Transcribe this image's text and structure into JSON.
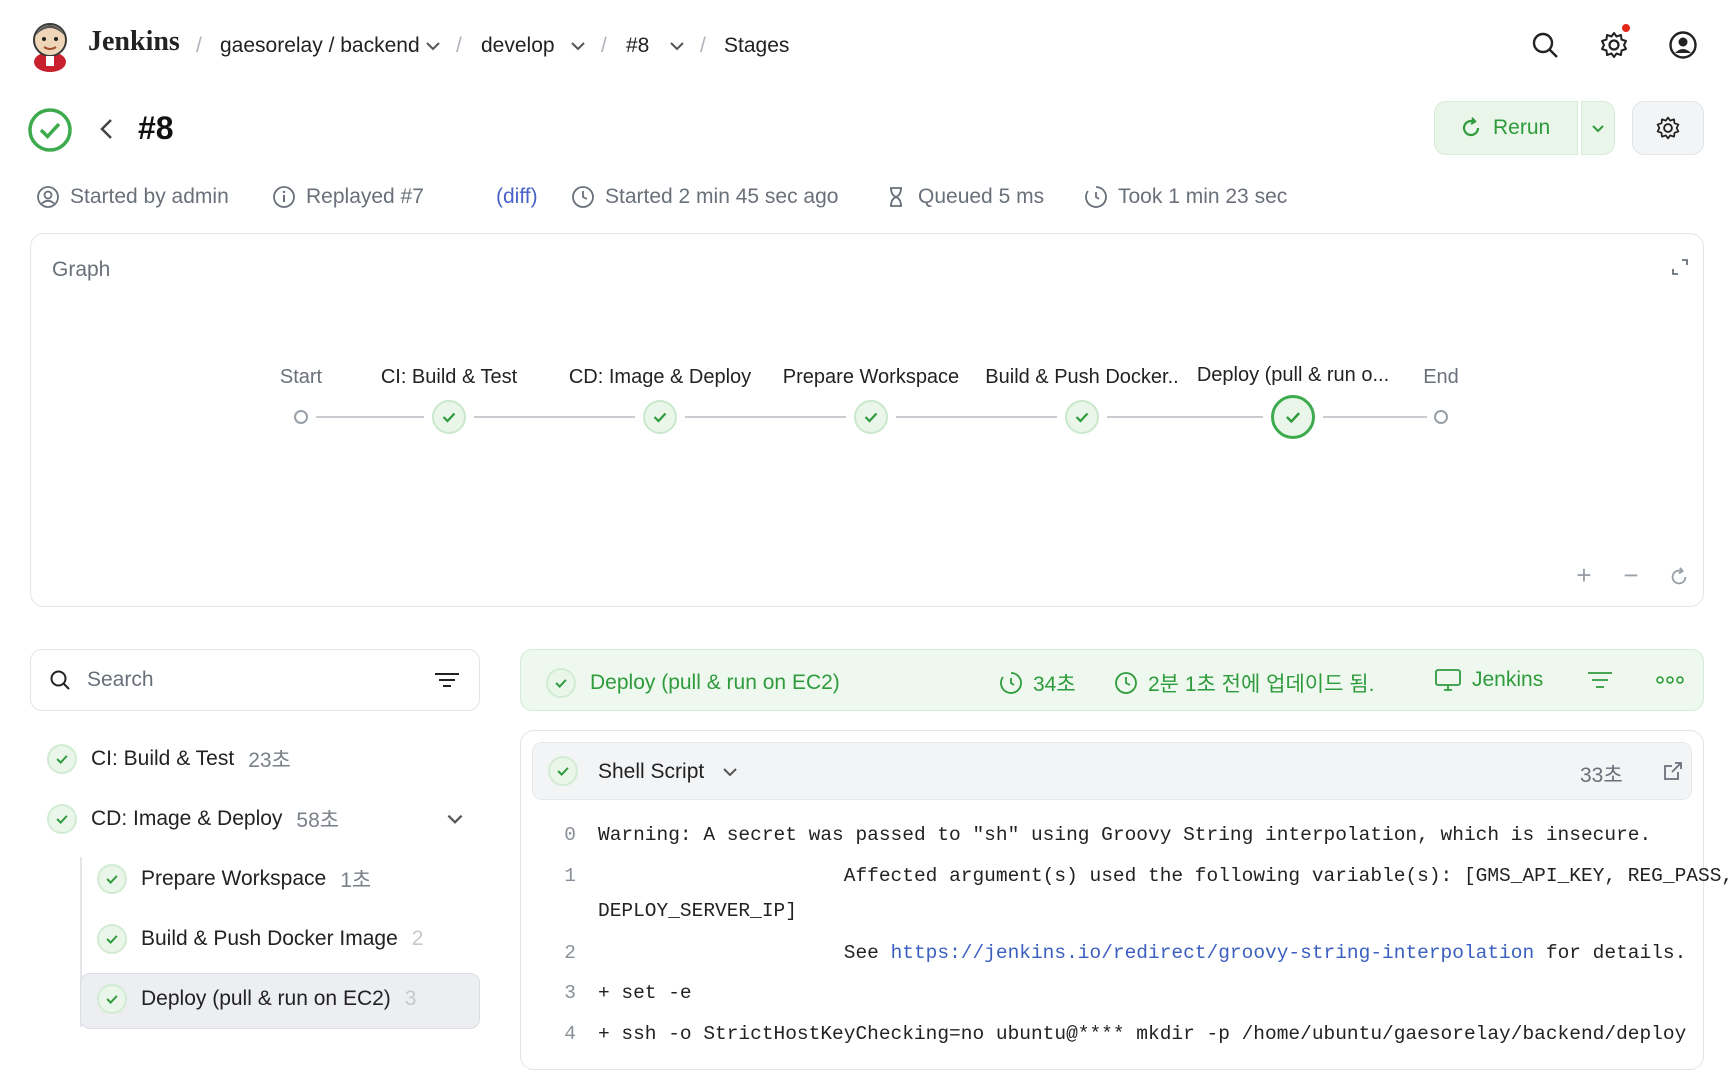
{
  "header": {
    "brand": "Jenkins",
    "breadcrumbs": [
      {
        "label": "gaesorelay / backend",
        "has_dropdown": true
      },
      {
        "label": "develop",
        "has_dropdown": true
      },
      {
        "label": "#8",
        "has_dropdown": true
      },
      {
        "label": "Stages",
        "has_dropdown": false
      }
    ],
    "icons": [
      "search-icon",
      "settings-icon",
      "user-icon"
    ]
  },
  "run": {
    "status": "success",
    "title": "#8",
    "rerun_label": "Rerun",
    "meta": {
      "started_by": "Started by admin",
      "replayed": "Replayed #7",
      "diff": "(diff)",
      "started": "Started 2 min 45 sec ago",
      "queued": "Queued 5 ms",
      "took": "Took 1 min 23 sec"
    }
  },
  "graph": {
    "label": "Graph",
    "start_label": "Start",
    "end_label": "End",
    "stages": [
      {
        "label": "CI: Build & Test",
        "status": "success"
      },
      {
        "label": "CD: Image & Deploy",
        "status": "success"
      },
      {
        "label": "Prepare Workspace",
        "status": "success"
      },
      {
        "label": "Build & Push Docker..",
        "status": "success"
      },
      {
        "label": "Deploy (pull & run o...",
        "status": "success",
        "selected": true
      }
    ]
  },
  "sidebar": {
    "search_placeholder": "Search",
    "stages": [
      {
        "label": "CI: Build & Test",
        "duration": "23초"
      },
      {
        "label": "CD: Image & Deploy",
        "duration": "58초"
      },
      {
        "label": "Prepare Workspace",
        "duration": "1초"
      },
      {
        "label": "Build & Push Docker Image",
        "duration": "2"
      },
      {
        "label": "Deploy (pull & run on EC2)",
        "duration": "3"
      }
    ]
  },
  "stage_detail": {
    "name": "Deploy (pull & run on EC2)",
    "duration": "34초",
    "updated": "2분 1초 전에 업데이드 됨.",
    "agent": "Jenkins"
  },
  "step": {
    "name": "Shell Script",
    "duration": "33초"
  },
  "log": [
    {
      "n": "0",
      "text": "Warning: A secret was passed to \"sh\" using Groovy String interpolation, which is insecure."
    },
    {
      "n": "1",
      "text": "\t\t Affected argument(s) used the following variable(s): [GMS_API_KEY, REG_PASS,"
    },
    {
      "n": "",
      "text": "DEPLOY_SERVER_IP]"
    },
    {
      "n": "2",
      "pre": "\t\t See ",
      "link": "https://jenkins.io/redirect/groovy-string-interpolation",
      "post": " for details."
    },
    {
      "n": "3",
      "text": "+ set -e"
    },
    {
      "n": "4",
      "text": "+ ssh -o StrictHostKeyChecking=no ubuntu@**** mkdir -p /home/ubuntu/gaesorelay/backend/deploy"
    }
  ],
  "colors": {
    "accent_green": "#2e9b3c",
    "link_blue": "#3b5fc0",
    "notification_dot": "#e5271b"
  }
}
